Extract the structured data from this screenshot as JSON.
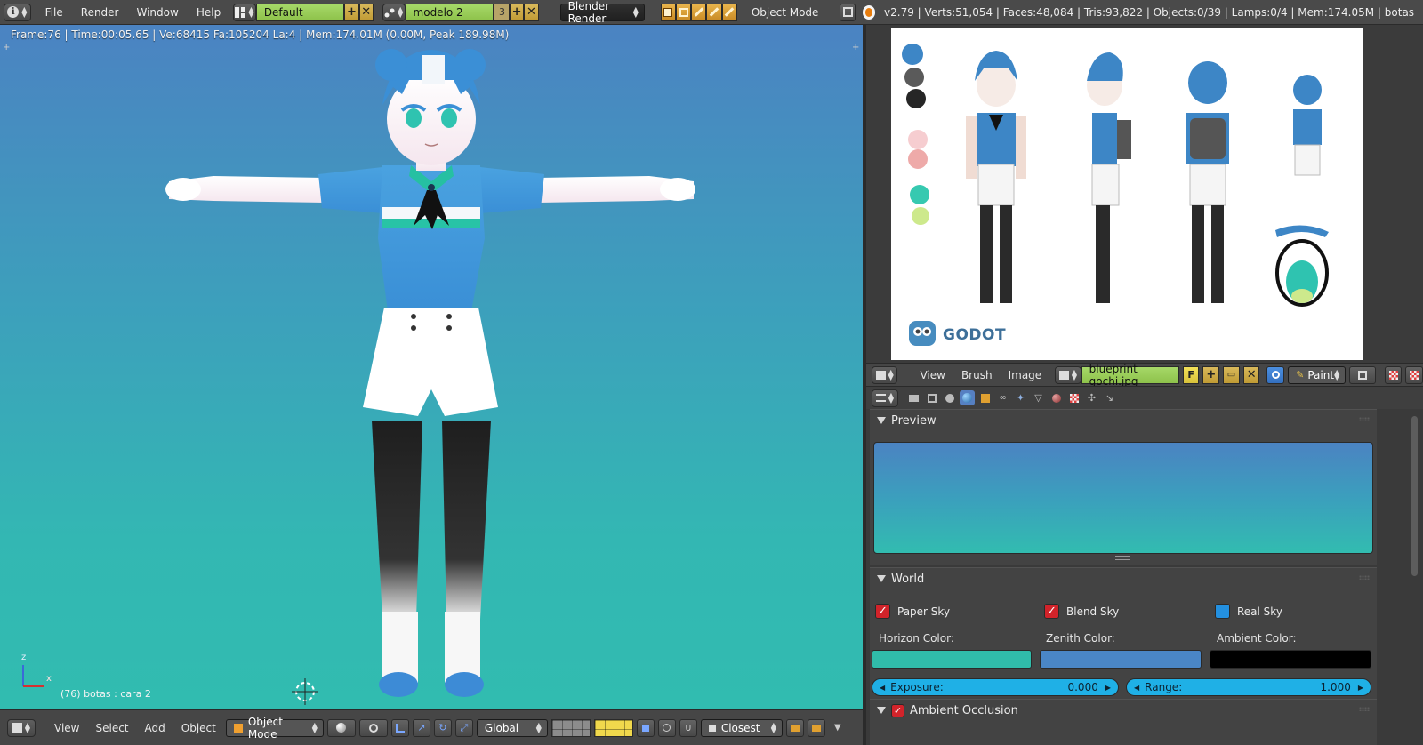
{
  "top_bar": {
    "menus": [
      "File",
      "Render",
      "Window",
      "Help"
    ],
    "screen_layout": "Default",
    "scene": "modelo 2",
    "scene_users": "3",
    "render_engine": "Blender Render",
    "mode": "Object Mode",
    "stats": "v2.79 | Verts:51,054 | Faces:48,084 | Tris:93,822 | Objects:0/39 | Lamps:0/4 | Mem:174.05M | botas"
  },
  "viewport": {
    "info": "Frame:76 | Time:00:05.65 | Ve:68415 Fa:105204 La:4 | Mem:174.01M (0.00M, Peak 189.98M)",
    "object_label": "(76) botas : cara 2",
    "axis_z": "z",
    "axis_x": "x",
    "background_top": "#4b83c2",
    "background_bottom": "#31bcb0"
  },
  "viewport_header": {
    "menus": [
      "View",
      "Select",
      "Add",
      "Object"
    ],
    "mode": "Object Mode",
    "orientation": "Global",
    "snap_target": "Closest"
  },
  "image_editor": {
    "logo_text": "GODOT",
    "menus": [
      "View",
      "Brush",
      "Image"
    ],
    "image_name": "blueprint gochi.jpg",
    "fake_user": "F",
    "mode": "Paint",
    "palette": [
      "#3d86c6",
      "#5a5a5a",
      "#262626",
      "#f6cdd0",
      "#eeaaa9",
      "#36c9b0",
      "#cde98c"
    ]
  },
  "properties": {
    "preview_title": "Preview",
    "world_title": "World",
    "paper_sky": "Paper Sky",
    "blend_sky": "Blend Sky",
    "real_sky": "Real Sky",
    "horizon_label": "Horizon Color:",
    "zenith_label": "Zenith Color:",
    "ambient_label": "Ambient Color:",
    "horizon_color": "#30bcaa",
    "zenith_color": "#4a86c6",
    "ambient_color": "#000000",
    "exposure_label": "Exposure:",
    "exposure_value": "0.000",
    "range_label": "Range:",
    "range_value": "1.000",
    "ao_title": "Ambient Occlusion"
  }
}
